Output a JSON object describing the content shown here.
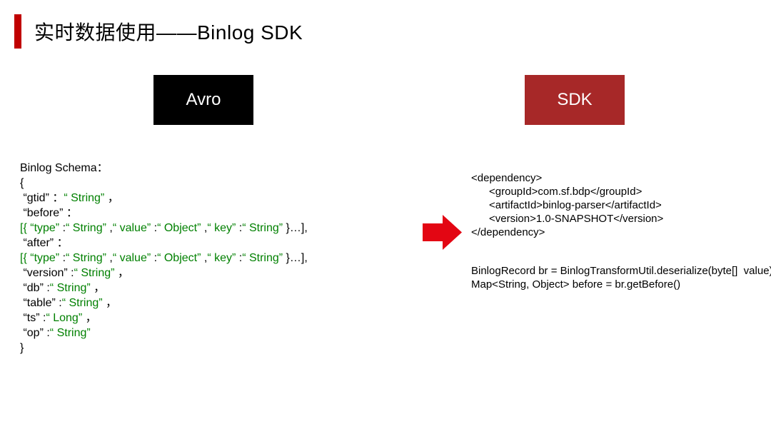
{
  "title": "实时数据使用——Binlog SDK",
  "boxes": {
    "avro": "Avro",
    "sdk": "SDK"
  },
  "schema": {
    "heading": "Binlog Schema：",
    "open": "{",
    "close": "}",
    "gtid_k": "“gtid”",
    "gtid_c": " ：",
    "gtid_v": "“ String”",
    "gtid_t": " ，",
    "before_k": "“before”",
    "before_c": " ：",
    "arr1_o": "[{ ",
    "arr1_tk": "“type”",
    "arr1_tc": " :",
    "arr1_tv": "“ String”",
    "arr1_s1": " ,",
    "arr1_vk": "“ value”",
    "arr1_vc": " :",
    "arr1_vv": "“ Object”",
    "arr1_s2": " ,",
    "arr1_kk": "“ key”",
    "arr1_kc": " :",
    "arr1_kv": "“ String”",
    "arr1_cl": " }…],",
    "after_k": "“after”",
    "after_c": " ：",
    "arr2_o": "[{ ",
    "arr2_tk": "“type”",
    "arr2_tc": " :",
    "arr2_tv": "“ String”",
    "arr2_s1": " ,",
    "arr2_vk": "“ value”",
    "arr2_vc": " :",
    "arr2_vv": "“ Object”",
    "arr2_s2": " ,",
    "arr2_kk": "“ key”",
    "arr2_kc": " :",
    "arr2_kv": "“ String”",
    "arr2_cl": " }…],",
    "ver_k": "“version”",
    "ver_c": " :",
    "ver_v": "“ String”",
    "ver_t": " ，",
    "db_k": "“db”",
    "db_c": " :",
    "db_v": "“ String”",
    "db_t": " ，",
    "tbl_k": "“table”",
    "tbl_c": " :",
    "tbl_v": "“ String”",
    "tbl_t": " ，",
    "ts_k": "“ts”",
    "ts_c": " :",
    "ts_v": "“ Long”",
    "ts_t": " ，",
    "op_k": "“op”",
    "op_c": " :",
    "op_v": "“ String”"
  },
  "dependency": "<dependency>\n      <groupId>com.sf.bdp</groupId>\n      <artifactId>binlog-parser</artifactId>\n      <version>1.0-SNAPSHOT</version>\n</dependency>",
  "code": "BinlogRecord br = BinlogTransformUtil.deserialize(byte[]  value)\nMap<String, Object> before = br.getBefore()"
}
